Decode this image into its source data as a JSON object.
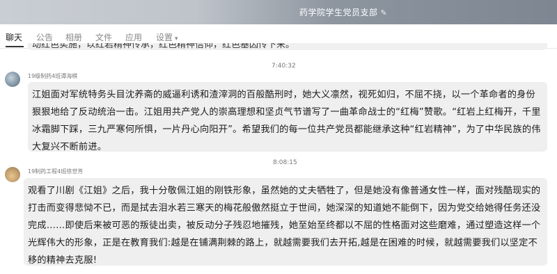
{
  "header": {
    "title": "药学院学生党员支部",
    "edit_icon": "pencil-icon"
  },
  "tabs": [
    {
      "label": "聊天",
      "active": true
    },
    {
      "label": "公告"
    },
    {
      "label": "相册"
    },
    {
      "label": "文件"
    },
    {
      "label": "应用"
    },
    {
      "label": "设置",
      "caret": "▾"
    }
  ],
  "messages": [
    {
      "partial_text": "动红色实施，以红岩精神传承，红色精神信仰，红色基因传下来。",
      "timestamp": "7:40:32",
      "sender": "19级制药4班谭海棋",
      "text": "江姐面对军统特务头目沈养斋的威逼利诱和渣滓洞的百般酷刑时，她大义凛然，视死如归，不屈不挠，以一个革命者的身份狠狠地给了反动统治一击。江姐用共产党人的崇高理想和坚贞气节谱写了一曲革命战士的“红梅”赞歌。“红岩上红梅开，千里冰霜脚下踩，三九严寒何所惧，一片丹心向阳开”。希望我们的每一位共产党员都能继承这种“红岩精神”，为了中华民族的伟大复兴不断前进。"
    },
    {
      "timestamp": "8:08:15",
      "sender": "19制药工程4班徐世芳",
      "text": "观看了川剧《江姐》之后，我十分敬佩江姐的刚铁形象，虽然她的丈夫牺牲了，但是她没有像普通女性一样，面对残酷现实的打击而变得悲恸不已，而是拭去泪水若三寒天的梅花般傲然挺立于世间，她深深的知道她不能倒下，因为党交给她得任务还没完成……即使后来被可恶的叛徒出卖，被反动分子残忍地摧残，她至始至终都以不屈的性格面对这些磨难，通过塑造这样一个光辉伟大的形象，正是在教育我们:越是在铺满荆棘的路上，就越需要我们去开拓,越是在困难的时候，就越需要我们以坚定不移的精神去克服!"
    }
  ]
}
